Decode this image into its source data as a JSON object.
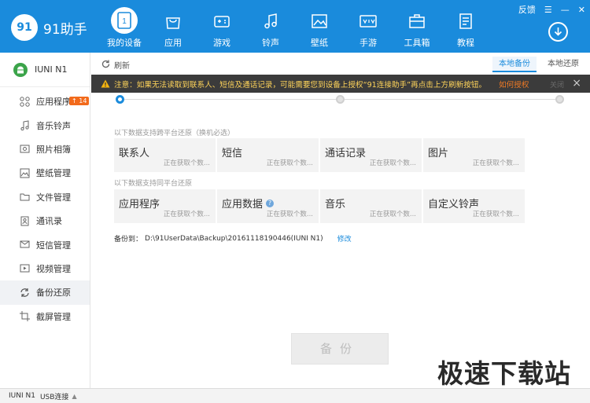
{
  "app": {
    "logo_text": "91助手",
    "logo_badge_num": "91"
  },
  "window": {
    "feedback": "反馈",
    "menu": "☰",
    "minimize": "—",
    "close": "✕"
  },
  "nav": [
    {
      "label": "我的设备",
      "icon": "device-icon",
      "active": true,
      "digit": "1"
    },
    {
      "label": "应用",
      "icon": "app-bag-icon"
    },
    {
      "label": "游戏",
      "icon": "gamepad-icon"
    },
    {
      "label": "铃声",
      "icon": "music-note-icon"
    },
    {
      "label": "壁纸",
      "icon": "picture-icon"
    },
    {
      "label": "手游",
      "icon": "mobile-game-icon"
    },
    {
      "label": "工具箱",
      "icon": "toolbox-icon"
    },
    {
      "label": "教程",
      "icon": "tutorial-icon"
    }
  ],
  "sidebar": {
    "device_name": "IUNI N1",
    "items": [
      {
        "label": "应用程序",
        "icon": "apps-grid-icon",
        "badge": "14"
      },
      {
        "label": "音乐铃声",
        "icon": "music-icon"
      },
      {
        "label": "照片相簿",
        "icon": "photo-icon"
      },
      {
        "label": "壁纸管理",
        "icon": "wallpaper-icon"
      },
      {
        "label": "文件管理",
        "icon": "folder-icon"
      },
      {
        "label": "通讯录",
        "icon": "contacts-icon"
      },
      {
        "label": "短信管理",
        "icon": "sms-icon"
      },
      {
        "label": "视频管理",
        "icon": "video-icon"
      },
      {
        "label": "备份还原",
        "icon": "sync-icon",
        "active": true
      },
      {
        "label": "截屏管理",
        "icon": "crop-icon"
      }
    ]
  },
  "toolbar": {
    "refresh_label": "刷新",
    "tabs": [
      {
        "label": "本地备份",
        "active": true
      },
      {
        "label": "本地还原"
      }
    ]
  },
  "notice": {
    "text": "注意：如果无法读取到联系人、短信及通话记录，可能需要您到设备上授权“91连接助手”再点击上方刷新按钮。",
    "link": "如何授权",
    "dismiss": "关闭"
  },
  "cross_platform": {
    "label": "以下数据支持跨平台还原（换机必选）",
    "tiles": [
      {
        "title": "联系人",
        "status": "正在获取个数..."
      },
      {
        "title": "短信",
        "status": "正在获取个数..."
      },
      {
        "title": "通话记录",
        "status": "正在获取个数..."
      },
      {
        "title": "图片",
        "status": "正在获取个数..."
      }
    ]
  },
  "same_platform": {
    "label": "以下数据支持同平台还原",
    "tiles": [
      {
        "title": "应用程序",
        "status": "正在获取个数..."
      },
      {
        "title": "应用数据",
        "status": "正在获取个数...",
        "help": "?"
      },
      {
        "title": "音乐",
        "status": "正在获取个数..."
      },
      {
        "title": "自定义铃声",
        "status": "正在获取个数..."
      }
    ]
  },
  "backup": {
    "path_label": "备份到：",
    "path": "D:\\91UserData\\Backup\\20161118190446(IUNI N1)",
    "modify_label": "修改",
    "button_label": "备份"
  },
  "watermark": "极速下载站",
  "statusbar": {
    "device": "IUNI N1",
    "connection": "USB连接",
    "arrow": "▲"
  },
  "colors": {
    "brand": "#1a8bdc",
    "notice_bg": "#3b3b3b",
    "notice_text": "#ffd45a",
    "badge": "#f26a1b"
  }
}
